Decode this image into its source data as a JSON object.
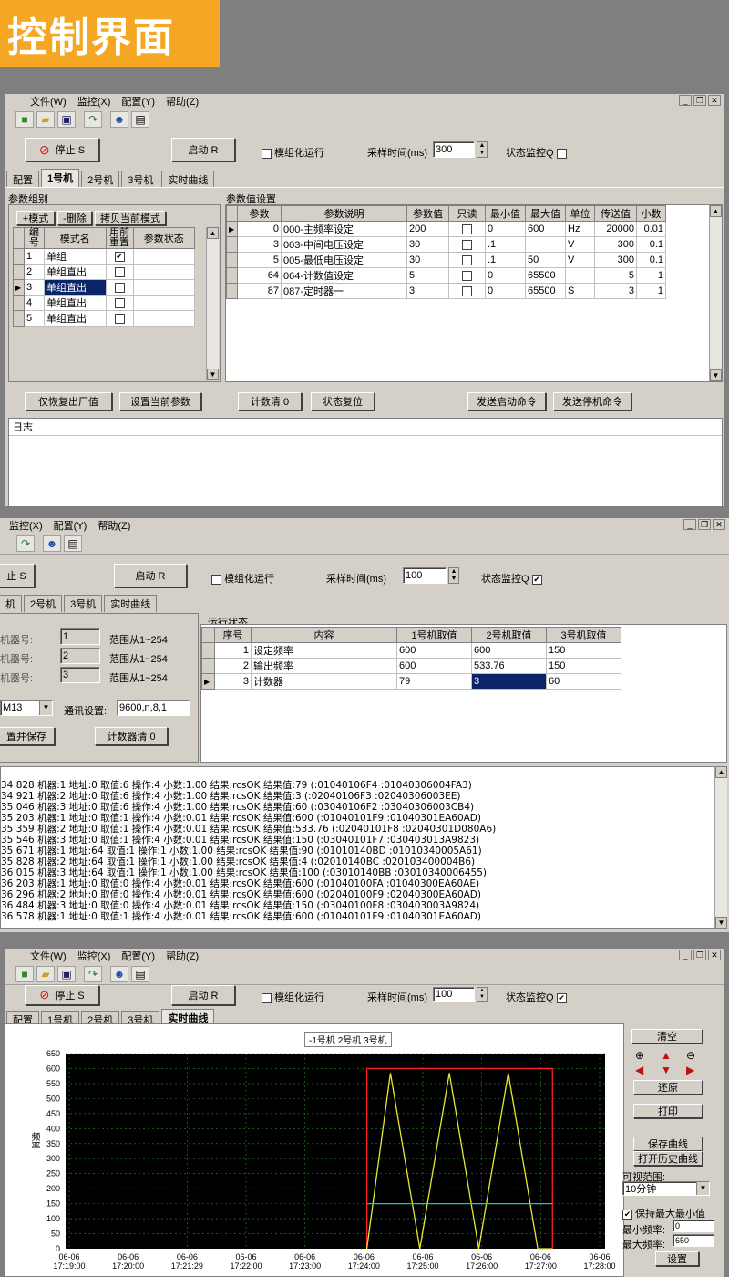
{
  "banner": {
    "title": "控制界面"
  },
  "menu1": [
    "文件(W)",
    "监控(X)",
    "配置(Y)",
    "帮助(Z)"
  ],
  "menu2": [
    "监控(X)",
    "配置(Y)",
    "帮助(Z)"
  ],
  "controls": {
    "stop": "停止 S",
    "stop_partial": "止 S",
    "start": "启动 R",
    "modular": "模组化运行",
    "sample_label": "采样时间(ms)",
    "sample_value_1": "300",
    "sample_value_2": "100",
    "sample_value_3": "100",
    "status_monitor": "状态监控Q"
  },
  "tabs1": [
    "配置",
    "1号机",
    "2号机",
    "3号机",
    "实时曲线"
  ],
  "tabs2": [
    "机",
    "2号机",
    "3号机",
    "实时曲线"
  ],
  "tabs3": [
    "配置",
    "1号机",
    "2号机",
    "3号机",
    "实时曲线"
  ],
  "param_group": {
    "title": "参数组别",
    "buttons": [
      "+模式",
      "-删除",
      "拷贝当前模式"
    ],
    "headers": [
      "编号",
      "模式名",
      "用前重置",
      "参数状态"
    ],
    "rows": [
      {
        "id": "1",
        "name": "单组",
        "reset": "✔"
      },
      {
        "id": "2",
        "name": "单组直出",
        "reset": ""
      },
      {
        "id": "3",
        "name": "单组直出",
        "reset": ""
      },
      {
        "id": "4",
        "name": "单组直出",
        "reset": ""
      },
      {
        "id": "5",
        "name": "单组直出",
        "reset": ""
      }
    ]
  },
  "param_set": {
    "title": "参数值设置",
    "headers": [
      "参数",
      "参数说明",
      "参数值",
      "只读",
      "最小值",
      "最大值",
      "单位",
      "传送值",
      "小数"
    ],
    "rows": [
      {
        "p": "0",
        "desc": "000-主频率设定",
        "val": "200",
        "min": "0",
        "max": "600",
        "unit": "Hz",
        "send": "20000",
        "dec": "0.01"
      },
      {
        "p": "3",
        "desc": "003-中间电压设定",
        "val": "30",
        "min": ".1",
        "max": "",
        "unit": "V",
        "send": "300",
        "dec": "0.1"
      },
      {
        "p": "5",
        "desc": "005-最低电压设定",
        "val": "30",
        "min": ".1",
        "max": "50",
        "unit": "V",
        "send": "300",
        "dec": "0.1"
      },
      {
        "p": "64",
        "desc": "064-计数值设定",
        "val": "5",
        "min": "0",
        "max": "65500",
        "unit": "",
        "send": "5",
        "dec": "1"
      },
      {
        "p": "87",
        "desc": "087-定时器一",
        "val": "3",
        "min": "0",
        "max": "65500",
        "unit": "S",
        "send": "3",
        "dec": "1"
      }
    ]
  },
  "bottom_buttons": [
    "仅恢复出厂值",
    "设置当前参数",
    "计数清 0",
    "状态复位",
    "发送启动命令",
    "发送停机命令"
  ],
  "log_title": "日志",
  "machine": {
    "labels": [
      "机器号:",
      "机器号:",
      "机器号:"
    ],
    "values": [
      "1",
      "2",
      "3"
    ],
    "range": "范围从1~254",
    "port": "M13",
    "comm_label": "通讯设置:",
    "comm_value": "9600,n,8,1",
    "save_btn": "置并保存",
    "counter_btn": "计数器清 0"
  },
  "run_status": {
    "title": "运行状态",
    "headers": [
      "序号",
      "内容",
      "1号机取值",
      "2号机取值",
      "3号机取值"
    ],
    "rows": [
      {
        "n": "1",
        "c": "设定频率",
        "m1": "600",
        "m2": "600",
        "m3": "150"
      },
      {
        "n": "2",
        "c": "输出频率",
        "m1": "600",
        "m2": "533.76",
        "m3": "150"
      },
      {
        "n": "3",
        "c": "计数器",
        "m1": "79",
        "m2": "3",
        "m3": "60"
      }
    ]
  },
  "log_lines": [
    "34 828 机器:1 地址:0 取值:6 操作:4 小数:1.00 结果:rcsOK 结果值:79 (:01040106F4 :01040306004FA3)",
    "34 921 机器:2 地址:0 取值:6 操作:4 小数:1.00 结果:rcsOK 结果值:3 (:02040106F3 :02040306003EE)",
    "35 046 机器:3 地址:0 取值:6 操作:4 小数:1.00 结果:rcsOK 结果值:60 (:03040106F2 :03040306003CB4)",
    "35 203 机器:1 地址:0 取值:1 操作:4 小数:0.01 结果:rcsOK 结果值:600 (:01040101F9 :01040301EA60AD)",
    "35 359 机器:2 地址:0 取值:1 操作:4 小数:0.01 结果:rcsOK 结果值:533.76 (:02040101F8 :02040301D080A6)",
    "35 546 机器:3 地址:0 取值:1 操作:4 小数:0.01 结果:rcsOK 结果值:150 (:03040101F7 :030403013A9823)",
    "35 671 机器:1 地址:64 取值:1 操作:1 小数:1.00 结果:rcsOK 结果值:90 (:01010140BD :01010340005A61)",
    "35 828 机器:2 地址:64 取值:1 操作:1 小数:1.00 结果:rcsOK 结果值:4 (:02010140BC :020103400004B6)",
    "36 015 机器:3 地址:64 取值:1 操作:1 小数:1.00 结果:rcsOK 结果值:100 (:03010140BB :03010340006455)",
    "36 203 机器:1 地址:0 取值:0 操作:4 小数:0.01 结果:rcsOK 结果值:600 (:01040100FA :01040300EA60AE)",
    "36 296 机器:2 地址:0 取值:0 操作:4 小数:0.01 结果:rcsOK 结果值:600 (:02040100F9 :02040300EA60AD)",
    "36 484 机器:3 地址:0 取值:0 操作:4 小数:0.01 结果:rcsOK 结果值:150 (:03040100F8 :030403003A9824)",
    "36 578 机器:1 地址:0 取值:1 操作:4 小数:0.01 结果:rcsOK 结果值:600 (:01040101F9 :01040301EA60AD)"
  ],
  "curve_panel": {
    "clear": "清空",
    "restore": "还原",
    "print": "打印",
    "save_curve": "保存曲线",
    "open_history": "打开历史曲线",
    "visible_range_label": "可视范围:",
    "visible_range_value": "10分钟",
    "keep_minmax": "保持最大最小值",
    "min_freq_label": "最小频率:",
    "min_freq_value": "0",
    "max_freq_label": "最大频率:",
    "max_freq_value": "650",
    "set": "设置"
  },
  "chart_data": {
    "type": "line",
    "legend": [
      "1号机",
      "2号机",
      "3号机"
    ],
    "ylabel": "频率",
    "ylim": [
      0,
      650
    ],
    "yticks": [
      0,
      50,
      100,
      150,
      200,
      250,
      300,
      350,
      400,
      450,
      500,
      550,
      600,
      650
    ],
    "xticks": [
      "06-06\n17:19:00",
      "06-06\n17:20:00",
      "06-06\n17:21:29",
      "06-06\n17:22:00",
      "06-06\n17:23:00",
      "06-06\n17:24:00",
      "06-06\n17:25:00",
      "06-06\n17:26:00",
      "06-06\n17:27:00",
      "06-06\n17:28:00"
    ],
    "series": [
      {
        "name": "1号机",
        "color": "#ff2020",
        "x": [
          5.05,
          5.05,
          8.2,
          8.2
        ],
        "y": [
          0,
          600,
          600,
          0
        ]
      },
      {
        "name": "2号机",
        "color": "#e8e830",
        "x": [
          5.05,
          5.45,
          5.95,
          6.45,
          6.95,
          7.45,
          7.95,
          8.2
        ],
        "y": [
          0,
          585,
          0,
          585,
          0,
          585,
          0,
          0
        ]
      },
      {
        "name": "3号机",
        "color": "#20c0d0",
        "x": [
          5.05,
          8.2
        ],
        "y": [
          150,
          150
        ]
      }
    ]
  },
  "colors": {
    "accent": "#0a246a",
    "banner": "#f5a623",
    "chart_bg": "#000000"
  }
}
